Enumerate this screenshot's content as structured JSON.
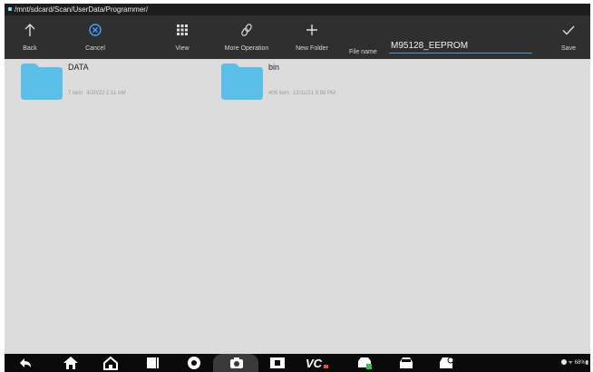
{
  "path": "/mnt/sdcard/Scan/UserData/Programmer/",
  "toolbar": {
    "back": {
      "label": "Back",
      "icon": "arrow-up-icon"
    },
    "cancel": {
      "label": "Cancel",
      "icon": "cancel-circle-icon"
    },
    "view": {
      "label": "View",
      "icon": "grid-icon"
    },
    "more_operation": {
      "label": "More Operation",
      "icon": "link-icon"
    },
    "new_folder": {
      "label": "New Folder",
      "icon": "plus-icon"
    },
    "file_name_label": "File name",
    "file_name_value": "M95128_EEPROM",
    "save": {
      "label": "Save",
      "icon": "check-icon"
    }
  },
  "folders": [
    {
      "name": "DATA",
      "items": "7 item",
      "date": "4/20/22 1:11 AM"
    },
    {
      "name": "bin",
      "items": "409 item",
      "date": "12/11/21 5:56 PM"
    }
  ],
  "status_bar": {
    "battery": "68%"
  },
  "colors": {
    "accent": "#3f9fe0",
    "cancel": "#3fa3ff",
    "folder": "#5bbfe8",
    "toolbar": "#2f2f2f",
    "navbar": "#0a0a0a",
    "content_bg": "#dcdcdc"
  }
}
